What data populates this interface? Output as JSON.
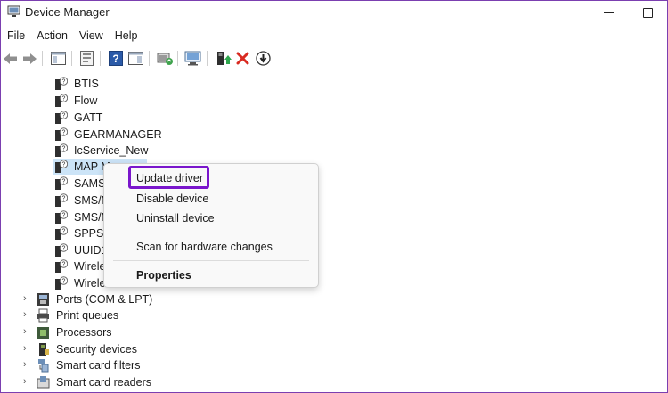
{
  "window": {
    "title": "Device Manager"
  },
  "menu": [
    "File",
    "Action",
    "View",
    "Help"
  ],
  "toolbar": {
    "icons": [
      "back-icon",
      "forward-icon",
      "show-hide-tree-icon",
      "properties-icon",
      "help-icon",
      "action-pane-icon",
      "update-driver-icon",
      "scan-hardware-icon",
      "enable-device-icon",
      "uninstall-icon",
      "disable-device-icon"
    ]
  },
  "tree": {
    "children": [
      "BTIS",
      "Flow",
      "GATT",
      "GEARMANAGER",
      "IcService_New",
      "MAP M",
      "SAMS",
      "SMS/M",
      "SMS/M",
      "SPPSE",
      "UUID1",
      "Wirele",
      "Wirele"
    ],
    "categories": [
      "Ports (COM & LPT)",
      "Print queues",
      "Processors",
      "Security devices",
      "Smart card filters",
      "Smart card readers"
    ]
  },
  "context_menu": {
    "update_driver": "Update driver",
    "disable_device": "Disable device",
    "uninstall_device": "Uninstall device",
    "scan_hardware": "Scan for hardware changes",
    "properties": "Properties"
  },
  "colors": {
    "highlight_border": "#7a16cc",
    "window_border": "#7b3fb0",
    "selection": "#cce4f7"
  }
}
